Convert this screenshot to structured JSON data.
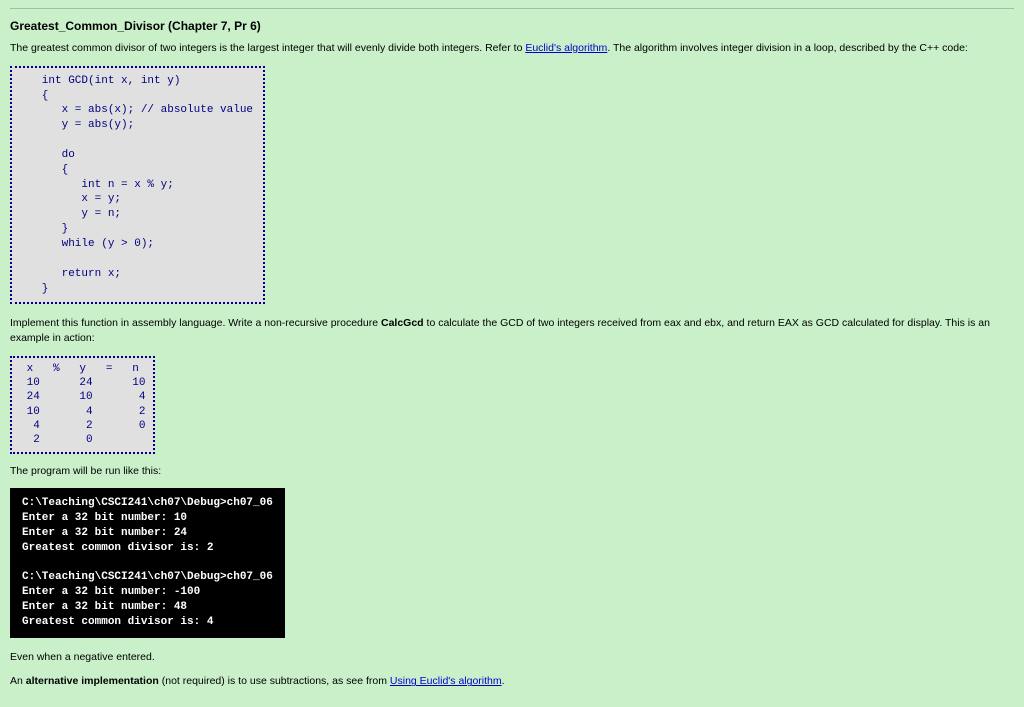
{
  "title": "Greatest_Common_Divisor (Chapter 7, Pr 6)",
  "intro_part1": "The greatest common divisor of two integers is the largest integer that will evenly divide both integers. Refer to ",
  "intro_link": "Euclid's algorithm",
  "intro_part2": ". The algorithm involves integer division in a loop, described by the C++ code:",
  "code": "   int GCD(int x, int y)\n   {\n      x = abs(x); // absolute value\n      y = abs(y);\n\n      do\n      {\n         int n = x % y;\n         x = y;\n         y = n;\n      }\n      while (y > 0);\n\n      return x;\n   }",
  "implement_part1": "Implement this function in assembly language. Write a non-recursive procedure ",
  "calcgcd": "CalcGcd",
  "implement_part2": " to calculate the GCD of two integers received from eax and ebx, and return EAX as GCD calculated for display. This is an example in action:",
  "table": " x   %   y   =   n\n 10      24      10\n 24      10       4\n 10       4       2\n  4       2       0\n  2       0",
  "run_label": "The program will be run like this:",
  "console": "C:\\Teaching\\CSCI241\\ch07\\Debug>ch07_06\nEnter a 32 bit number: 10\nEnter a 32 bit number: 24\nGreatest common divisor is: 2\n\nC:\\Teaching\\CSCI241\\ch07\\Debug>ch07_06\nEnter a 32 bit number: -100\nEnter a 32 bit number: 48\nGreatest common divisor is: 4",
  "negative_note": "Even when a negative entered.",
  "alt_part1": "An ",
  "alt_bold": "alternative implementation",
  "alt_part2": " (not required) is to use subtractions, as see from ",
  "alt_link": "Using Euclid's algorithm",
  "alt_part3": "."
}
